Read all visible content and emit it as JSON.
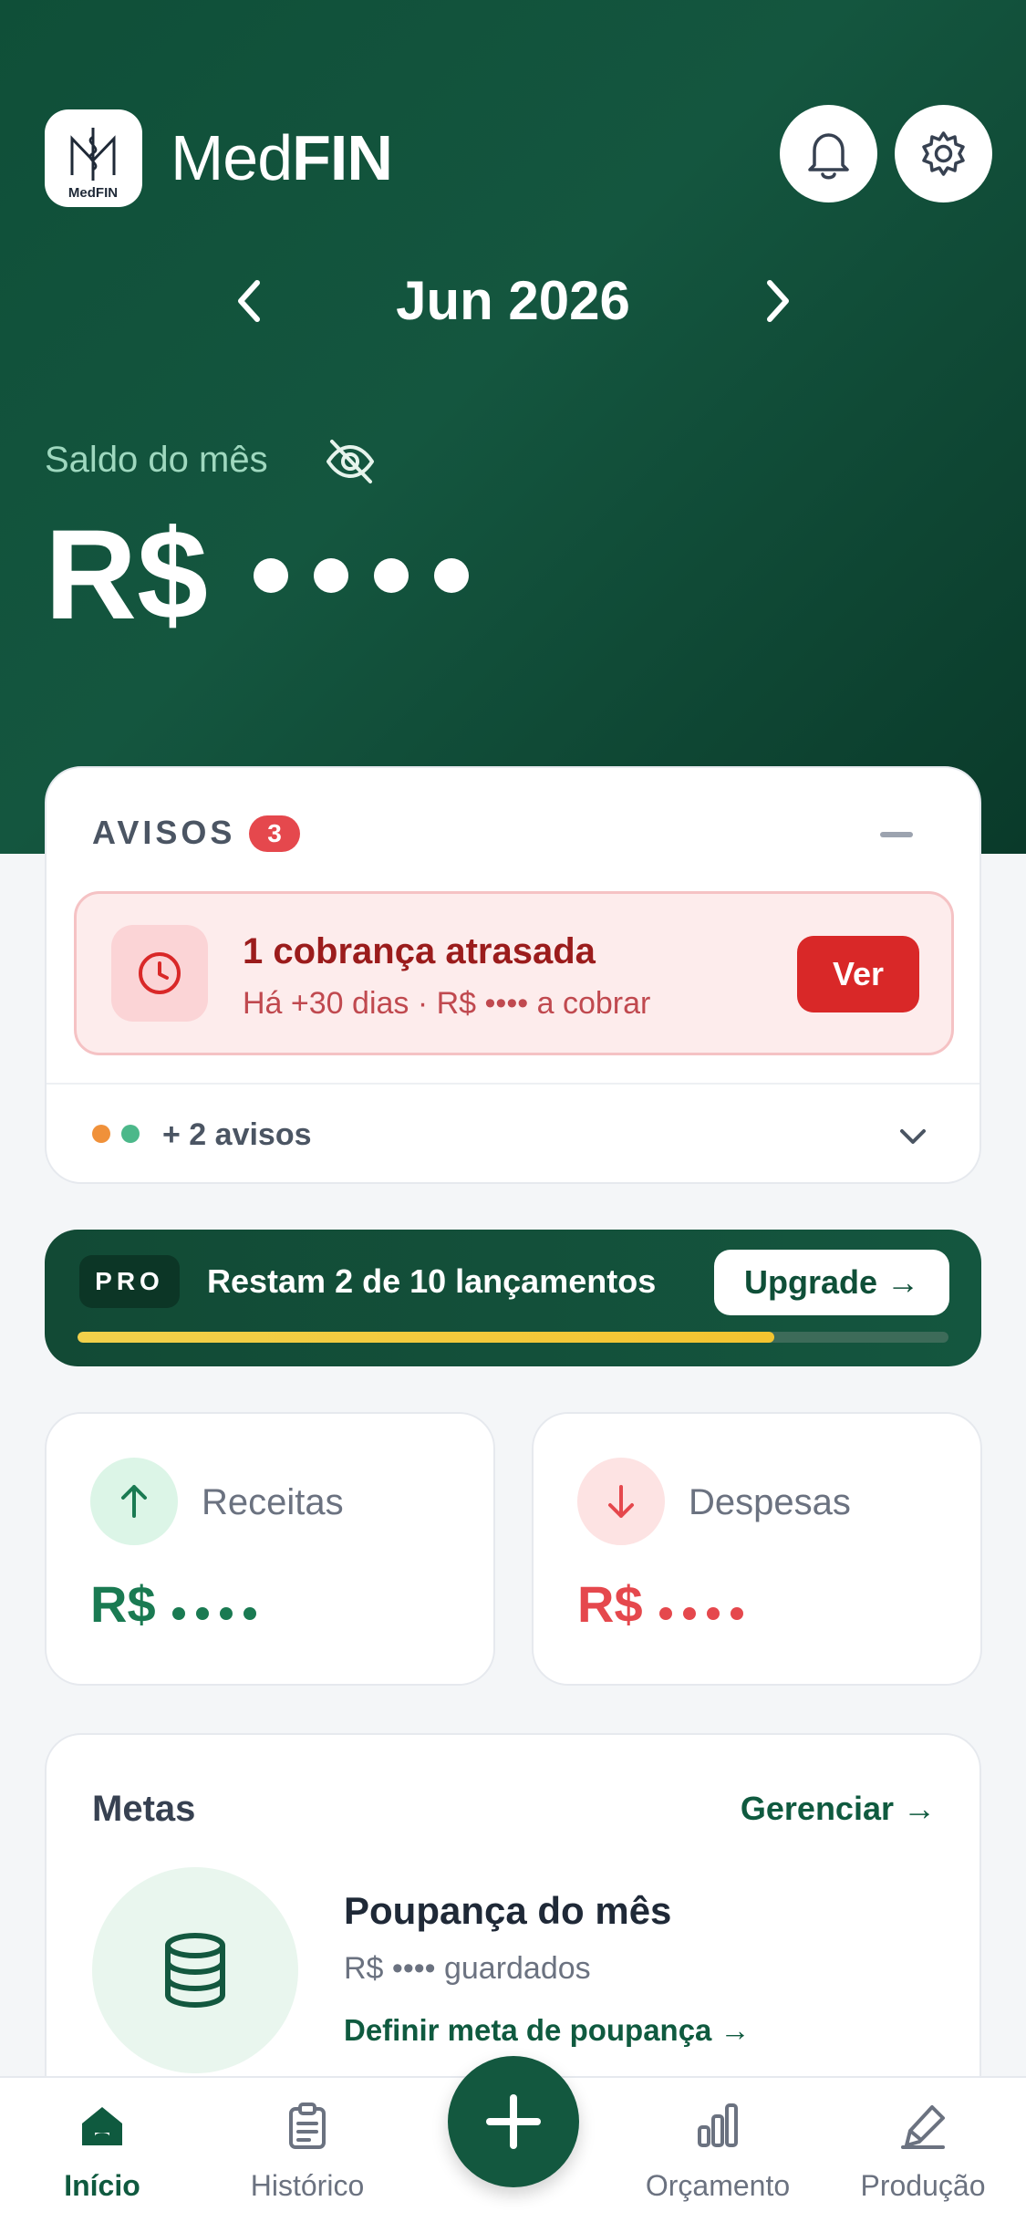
{
  "app": {
    "logo_text": "MedFIN",
    "brand_light": "Med",
    "brand_bold": "FIN"
  },
  "header": {
    "month": "Jun 2026",
    "balance_label": "Saldo do mês",
    "balance_currency": "R$",
    "balance_hidden": true
  },
  "avisos": {
    "title": "AVISOS",
    "count": "3",
    "alert_title": "1 cobrança atrasada",
    "alert_subtitle": "Há +30 dias · R$ •••• a cobrar",
    "alert_action": "Ver",
    "more_label": "+ 2 avisos",
    "more_dot_colors": [
      "#f0913a",
      "#4cb88a"
    ]
  },
  "pro": {
    "badge": "PRO",
    "text": "Restam 2 de 10 lançamentos",
    "upgrade_label": "Upgrade →",
    "used_fraction": 0.8
  },
  "stats": {
    "income_label": "Receitas",
    "income_currency": "R$",
    "expense_label": "Despesas",
    "expense_currency": "R$"
  },
  "metas": {
    "title": "Metas",
    "manage_label": "Gerenciar →",
    "goal_title": "Poupança do mês",
    "goal_subtitle": "R$ •••• guardados",
    "goal_link": "Definir meta de poupança →"
  },
  "nav": {
    "items": [
      {
        "label": "Início",
        "icon": "home-icon",
        "active": true
      },
      {
        "label": "Histórico",
        "icon": "clipboard-icon",
        "active": false
      },
      {
        "label": "Orçamento",
        "icon": "bar-chart-icon",
        "active": false
      },
      {
        "label": "Produção",
        "icon": "pen-icon",
        "active": false
      }
    ],
    "fab_icon": "plus-icon"
  },
  "colors": {
    "primary": "#0f4f38",
    "accent": "#0f5a3f",
    "income": "#1a7a52",
    "expense": "#e5484d",
    "progress": "#f2d14b"
  }
}
